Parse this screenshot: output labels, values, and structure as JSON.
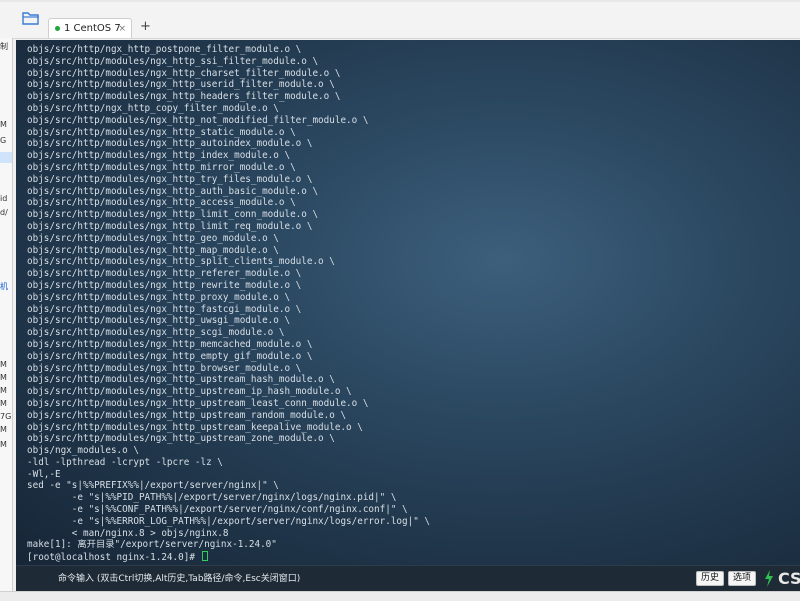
{
  "tabbar": {
    "tab_label": "1 CentOS 7",
    "close_glyph": "×",
    "add_glyph": "+"
  },
  "sidebar": {
    "labels": [
      "制",
      "M",
      "G",
      "id",
      "d/",
      "机",
      "M",
      "M",
      "M",
      "M",
      "7G",
      "M",
      "M"
    ]
  },
  "terminal": {
    "lines": [
      "objs/src/http/ngx_http_postpone_filter_module.o \\",
      "objs/src/http/modules/ngx_http_ssi_filter_module.o \\",
      "objs/src/http/modules/ngx_http_charset_filter_module.o \\",
      "objs/src/http/modules/ngx_http_userid_filter_module.o \\",
      "objs/src/http/modules/ngx_http_headers_filter_module.o \\",
      "objs/src/http/ngx_http_copy_filter_module.o \\",
      "objs/src/http/modules/ngx_http_not_modified_filter_module.o \\",
      "objs/src/http/modules/ngx_http_static_module.o \\",
      "objs/src/http/modules/ngx_http_autoindex_module.o \\",
      "objs/src/http/modules/ngx_http_index_module.o \\",
      "objs/src/http/modules/ngx_http_mirror_module.o \\",
      "objs/src/http/modules/ngx_http_try_files_module.o \\",
      "objs/src/http/modules/ngx_http_auth_basic_module.o \\",
      "objs/src/http/modules/ngx_http_access_module.o \\",
      "objs/src/http/modules/ngx_http_limit_conn_module.o \\",
      "objs/src/http/modules/ngx_http_limit_req_module.o \\",
      "objs/src/http/modules/ngx_http_geo_module.o \\",
      "objs/src/http/modules/ngx_http_map_module.o \\",
      "objs/src/http/modules/ngx_http_split_clients_module.o \\",
      "objs/src/http/modules/ngx_http_referer_module.o \\",
      "objs/src/http/modules/ngx_http_rewrite_module.o \\",
      "objs/src/http/modules/ngx_http_proxy_module.o \\",
      "objs/src/http/modules/ngx_http_fastcgi_module.o \\",
      "objs/src/http/modules/ngx_http_uwsgi_module.o \\",
      "objs/src/http/modules/ngx_http_scgi_module.o \\",
      "objs/src/http/modules/ngx_http_memcached_module.o \\",
      "objs/src/http/modules/ngx_http_empty_gif_module.o \\",
      "objs/src/http/modules/ngx_http_browser_module.o \\",
      "objs/src/http/modules/ngx_http_upstream_hash_module.o \\",
      "objs/src/http/modules/ngx_http_upstream_ip_hash_module.o \\",
      "objs/src/http/modules/ngx_http_upstream_least_conn_module.o \\",
      "objs/src/http/modules/ngx_http_upstream_random_module.o \\",
      "objs/src/http/modules/ngx_http_upstream_keepalive_module.o \\",
      "objs/src/http/modules/ngx_http_upstream_zone_module.o \\",
      "objs/ngx_modules.o \\",
      "-ldl -lpthread -lcrypt -lpcre -lz \\",
      "-Wl,-E",
      "sed -e \"s|%%PREFIX%%|/export/server/nginx|\" \\",
      "        -e \"s|%%PID_PATH%%|/export/server/nginx/logs/nginx.pid|\" \\",
      "        -e \"s|%%CONF_PATH%%|/export/server/nginx/conf/nginx.conf|\" \\",
      "        -e \"s|%%ERROR_LOG_PATH%%|/export/server/nginx/logs/error.log|\" \\",
      "        < man/nginx.8 > objs/nginx.8",
      "make[1]: 离开目录\"/export/server/nginx-1.24.0\""
    ],
    "prompt": "[root@localhost nginx-1.24.0]# "
  },
  "cmdbar": {
    "hint": "命令输入 (双击Ctrl切换,Alt历史,Tab路径/命令,Esc关闭窗口)",
    "history_label": "历史",
    "options_label": "选项",
    "badge": "CS"
  },
  "colors": {
    "cursor": "#32d05a",
    "terminal_text": "#d8dfe6",
    "bolt": "#2fc04f"
  }
}
